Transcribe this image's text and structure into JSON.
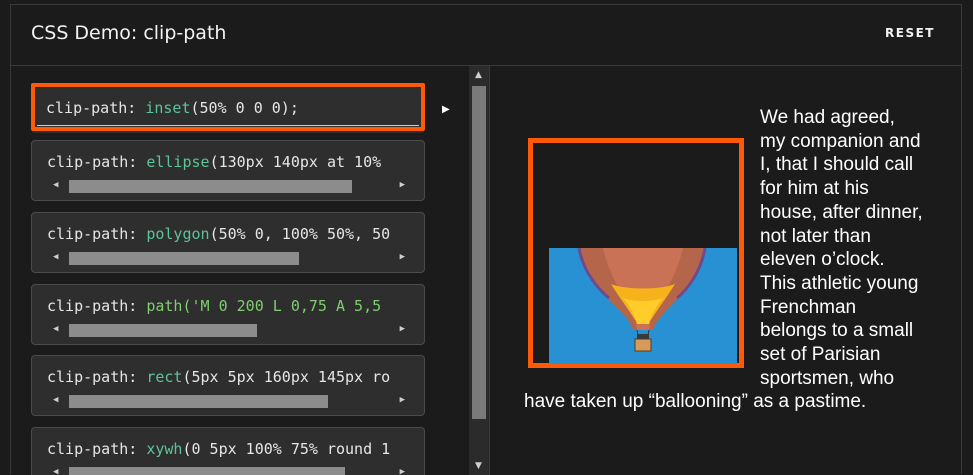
{
  "header": {
    "title": "CSS Demo: clip-path",
    "reset_label": "RESET"
  },
  "choices": [
    {
      "prop": "clip-path:",
      "fn": "inset",
      "args": "(50% 0 0 0);",
      "selected": true
    },
    {
      "prop": "clip-path:",
      "fn": "ellipse",
      "args": "(130px 140px at 10%",
      "selected": false
    },
    {
      "prop": "clip-path:",
      "fn": "polygon",
      "args": "(50% 0, 100% 50%, 50",
      "selected": false
    },
    {
      "prop": "clip-path:",
      "fn": "path",
      "args": "('M 0 200 L 0,75 A 5,5",
      "selected": false
    },
    {
      "prop": "clip-path:",
      "fn": "rect",
      "args": "(5px 5px 160px 145px ro",
      "selected": false
    },
    {
      "prop": "clip-path:",
      "fn": "xywh",
      "args": "(0 5px 100% 75% round 1",
      "selected": false
    }
  ],
  "output": {
    "text": "We had agreed, my companion and I, that I should call for him at his house, after dinner, not later than eleven o’clock. This athletic young Frenchman belongs to a small set of Parisian sportsmen, who have taken up “ballooning” as a pastime.",
    "image_subject": "hot-air-balloon"
  },
  "colors": {
    "accent": "#ff5a0a",
    "code_fn": "#5cc49a",
    "sky": "#2791d4"
  },
  "icons": {
    "scroll_left": "triangle-left-icon",
    "scroll_right": "triangle-right-icon",
    "scroll_up": "triangle-up-icon",
    "scroll_down": "triangle-down-icon",
    "selected_caret": "caret-right-icon"
  }
}
